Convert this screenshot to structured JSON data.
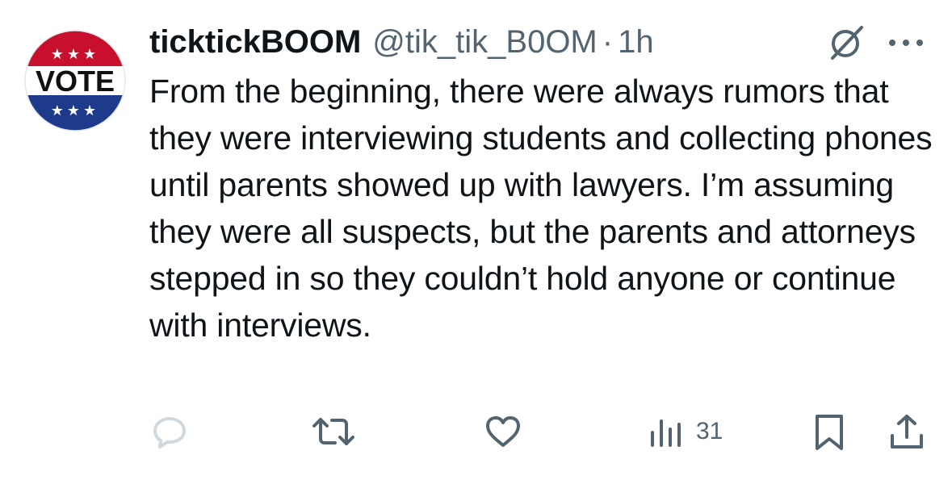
{
  "tweet": {
    "display_name": "ticktickBOOM",
    "handle": "@tik_tik_B0OM",
    "separator": "·",
    "time": "1h",
    "avatar": {
      "icon": "vote-sticker-icon",
      "text": "VOTE",
      "stars": "★★★",
      "colors": {
        "red": "#c8102e",
        "blue": "#1e3a8a",
        "white": "#ffffff"
      }
    },
    "text": "From the beginning, there were always rumors that they were interviewing students and collecting phones until parents showed up with lawyers. I’m assuming they were all suspects, but the parents and attorneys stepped in so they couldn’t hold anyone or continue with interviews."
  },
  "actions": {
    "reply_icon": "reply-icon",
    "repost_icon": "repost-icon",
    "like_icon": "heart-icon",
    "views_icon": "views-chart-icon",
    "views_count": "31",
    "bookmark_icon": "bookmark-icon",
    "share_icon": "share-icon"
  },
  "colors": {
    "text_primary": "#0f1419",
    "text_secondary": "#536471",
    "reply_disabled": "#cfd9de"
  }
}
